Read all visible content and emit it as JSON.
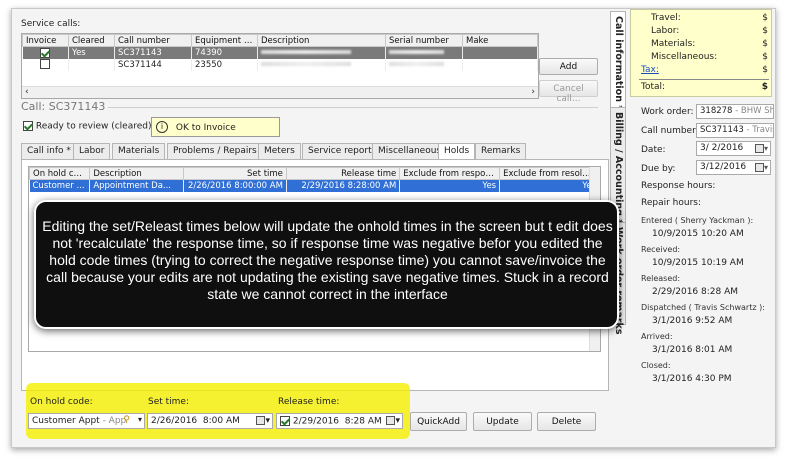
{
  "service_calls": {
    "section_label": "Service calls:",
    "columns": [
      "Invoice",
      "Cleared",
      "Call number",
      "Equipment nu...",
      "Description",
      "Serial number",
      "Make"
    ],
    "rows": [
      {
        "invoice": true,
        "cleared": "Yes",
        "call_number": "SC371143",
        "equipment": "74390"
      },
      {
        "invoice": false,
        "cleared": "",
        "call_number": "SC371144",
        "equipment": "23550"
      }
    ],
    "add_button": "Add",
    "cancel_button": "Cancel call..."
  },
  "call": {
    "title": "Call: SC371143",
    "ready_label": "Ready to review (cleared)",
    "ready_checked": true,
    "ok_invoice": "OK to Invoice"
  },
  "tabs": [
    "Call info *",
    "Labor",
    "Materials",
    "Problems / Repairs",
    "Meters",
    "Service report",
    "Miscellaneous",
    "Holds",
    "Remarks"
  ],
  "active_tab": "Holds",
  "holds": {
    "columns": [
      "On hold code",
      "Description",
      "Set time",
      "Release time",
      "Exclude from respon...",
      "Exclude from resolut..."
    ],
    "rows": [
      {
        "code": "Customer ...",
        "description": "Appointment Da...",
        "set_time": "2/26/2016 8:00:00 AM",
        "release_time": "2/29/2016 8:28:00 AM",
        "exclude_response": "Yes",
        "exclude_resolution": "Yes"
      }
    ]
  },
  "annotation": "Editing the set/Releast times below will update the onhold times in the screen but t edit does not 'recalculate' the response time, so if response time was negative befor you edited the hold code times (trying to correct the negative response time) you cannot save/invoice the call because your edits are not updating the existing save negative times.  Stuck in a record state we cannot correct in the interface",
  "footer": {
    "on_hold_label": "On hold code:",
    "on_hold_value": "Customer Appt",
    "on_hold_suffix": " - App",
    "set_time_label": "Set time:",
    "set_date": "2/26/2016",
    "set_time": "8:00 AM",
    "release_label": "Release time:",
    "release_date": "2/29/2016",
    "release_time": "8:28 AM",
    "release_checked": true,
    "quickadd": "QuickAdd",
    "update": "Update",
    "delete": "Delete"
  },
  "side_tabs": [
    "Call information *",
    "Billing / Accounting *",
    "Work order remarks"
  ],
  "totals": {
    "rows": [
      {
        "label": "Travel:",
        "value": "$"
      },
      {
        "label": "Labor:",
        "value": "$"
      },
      {
        "label": "Materials:",
        "value": "$"
      },
      {
        "label": "Miscellaneous:",
        "value": "$"
      },
      {
        "label": "Tax:",
        "value": "$"
      }
    ],
    "total_label": "Total:",
    "total_value": "$"
  },
  "right": {
    "work_order_label": "Work order:",
    "work_order_value": "318278",
    "work_order_suffix": " - BHW She",
    "call_number_label": "Call number:",
    "call_number_value": "SC371143",
    "call_number_suffix": " - Travis",
    "date_label": "Date:",
    "date_value": "3/  2/2016",
    "due_label": "Due by:",
    "due_value": "3/12/2016",
    "response_hours": "Response hours:",
    "repair_hours": "Repair hours:",
    "timeline": [
      {
        "label": "Entered ( Sherry Yackman ):",
        "value": "10/9/2015 10:20 AM"
      },
      {
        "label": "Received:",
        "value": "10/9/2015 10:19 AM"
      },
      {
        "label": "Released:",
        "value": "2/29/2016 8:28 AM"
      },
      {
        "label": "Dispatched ( Travis Schwartz ):",
        "value": "3/1/2016 9:52 AM"
      },
      {
        "label": "Arrived:",
        "value": "3/1/2016 8:01 AM"
      },
      {
        "label": "Closed:",
        "value": "3/1/2016 4:30 PM"
      }
    ]
  },
  "colors": {
    "highlight": "#f5f000",
    "annotation_bg": "#0f0f0f",
    "selected_row": "#2f6fd6",
    "tooltip_bg": "#ffffcc"
  }
}
